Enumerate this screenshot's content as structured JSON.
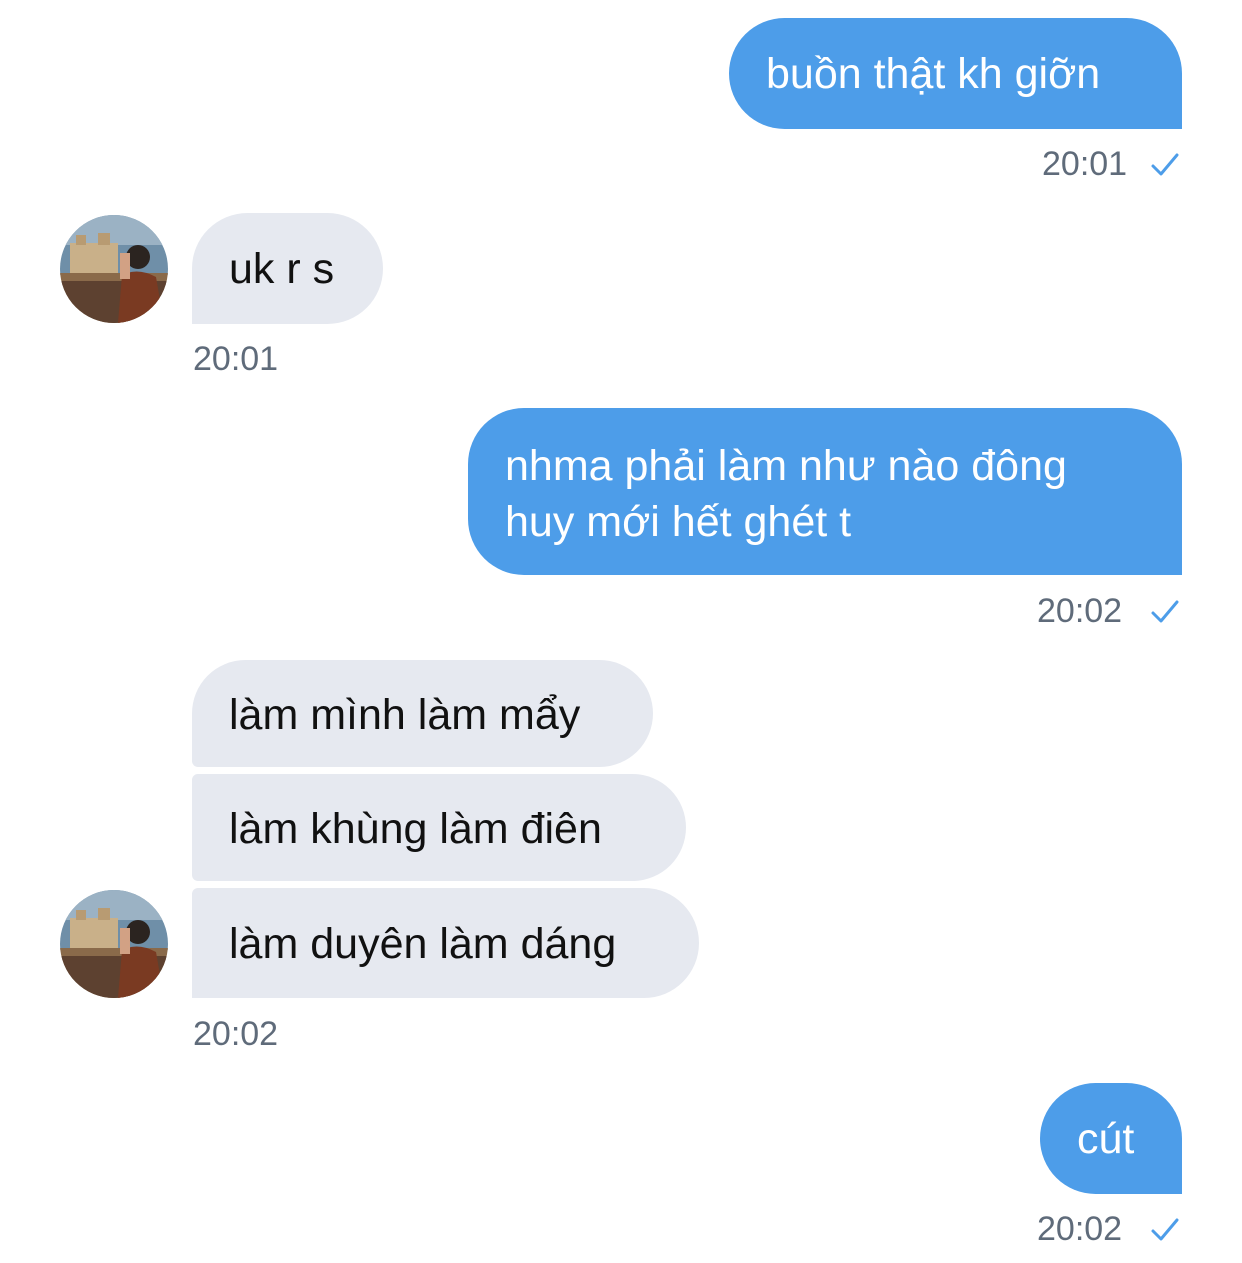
{
  "messages": {
    "m1": {
      "text": "buồn thật kh giỡn",
      "time": "20:01"
    },
    "m2": {
      "text": "uk r s",
      "time": "20:01"
    },
    "m3": {
      "line1": "nhma phải làm như nào đông",
      "line2": "huy mới hết ghét t",
      "time": "20:02"
    },
    "m4": {
      "text": "làm mình làm mẩy"
    },
    "m5": {
      "text": "làm khùng làm điên"
    },
    "m6": {
      "text": "làm duyên làm dáng",
      "time": "20:02"
    },
    "m7": {
      "text": "cút",
      "time": "20:02"
    }
  },
  "icons": {
    "read_receipt": "check-icon",
    "avatar": "contact-avatar"
  },
  "colors": {
    "outgoing_bubble": "#4d9de9",
    "incoming_bubble": "#e6e9f0",
    "timestamp": "#5f6b7a",
    "check": "#4d9de9"
  }
}
